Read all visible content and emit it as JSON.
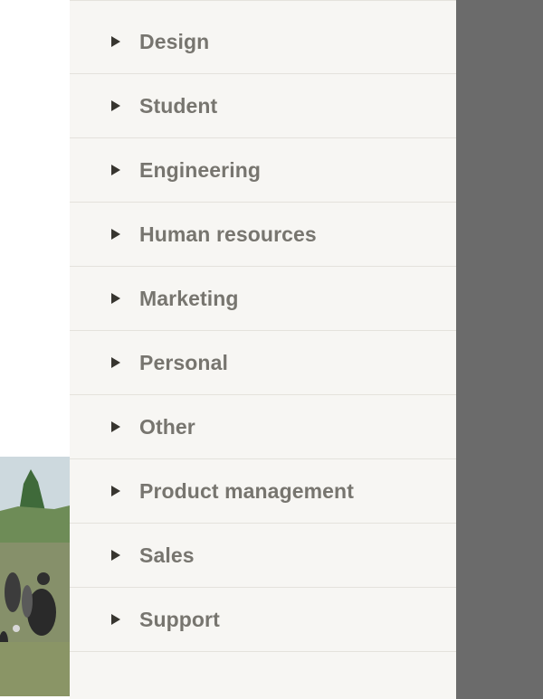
{
  "categories": {
    "items": [
      {
        "label": "Design"
      },
      {
        "label": "Student"
      },
      {
        "label": "Engineering"
      },
      {
        "label": "Human resources"
      },
      {
        "label": "Marketing"
      },
      {
        "label": "Personal"
      },
      {
        "label": "Other"
      },
      {
        "label": "Product management"
      },
      {
        "label": "Sales"
      },
      {
        "label": "Support"
      }
    ],
    "expand_icon": "triangle-right-icon"
  },
  "colors": {
    "panel_background": "#f7f6f3",
    "label_text": "#77756f",
    "arrow": "#37352f",
    "overlay": "#6b6b6b"
  }
}
